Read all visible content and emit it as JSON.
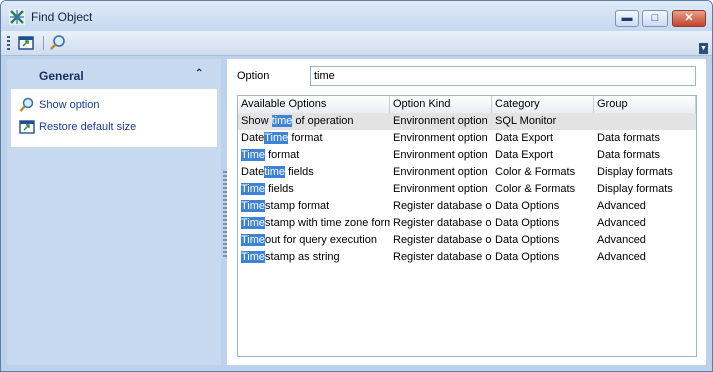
{
  "window": {
    "title": "Find Object"
  },
  "left_panel": {
    "header": "General",
    "tasks": [
      {
        "label": "Show option",
        "icon": "magnifier-icon"
      },
      {
        "label": "Restore default size",
        "icon": "restore-size-icon"
      }
    ]
  },
  "search": {
    "label": "Option",
    "value": "time"
  },
  "grid": {
    "columns": [
      "Available Options",
      "Option Kind",
      "Category",
      "Group"
    ],
    "rows": [
      {
        "pre": "Show ",
        "match": "time",
        "post": " of operation",
        "kind": "Environment option",
        "category": "SQL Monitor",
        "group": ""
      },
      {
        "pre": "Date",
        "match": "Time",
        "post": " format",
        "kind": "Environment option",
        "category": "Data Export",
        "group": "Data formats"
      },
      {
        "pre": "",
        "match": "Time",
        "post": " format",
        "kind": "Environment option",
        "category": "Data Export",
        "group": "Data formats"
      },
      {
        "pre": "Date",
        "match": "time",
        "post": " fields",
        "kind": "Environment option",
        "category": "Color & Formats",
        "group": "Display formats"
      },
      {
        "pre": "",
        "match": "Time",
        "post": " fields",
        "kind": "Environment option",
        "category": "Color & Formats",
        "group": "Display formats"
      },
      {
        "pre": "",
        "match": "Time",
        "post": "stamp format",
        "kind": "Register database option",
        "category": "Data Options",
        "group": "Advanced"
      },
      {
        "pre": "",
        "match": "Time",
        "post": "stamp with time zone format",
        "kind": "Register database option",
        "category": "Data Options",
        "group": "Advanced"
      },
      {
        "pre": "",
        "match": "Time",
        "post": "out for query execution",
        "kind": "Register database option",
        "category": "Data Options",
        "group": "Advanced"
      },
      {
        "pre": "",
        "match": "Time",
        "post": "stamp as string",
        "kind": "Register database option",
        "category": "Data Options",
        "group": "Advanced"
      }
    ]
  },
  "colors": {
    "highlight": "#3d83d6",
    "link": "#1a3a9a",
    "panel": "#c7d9ef"
  }
}
